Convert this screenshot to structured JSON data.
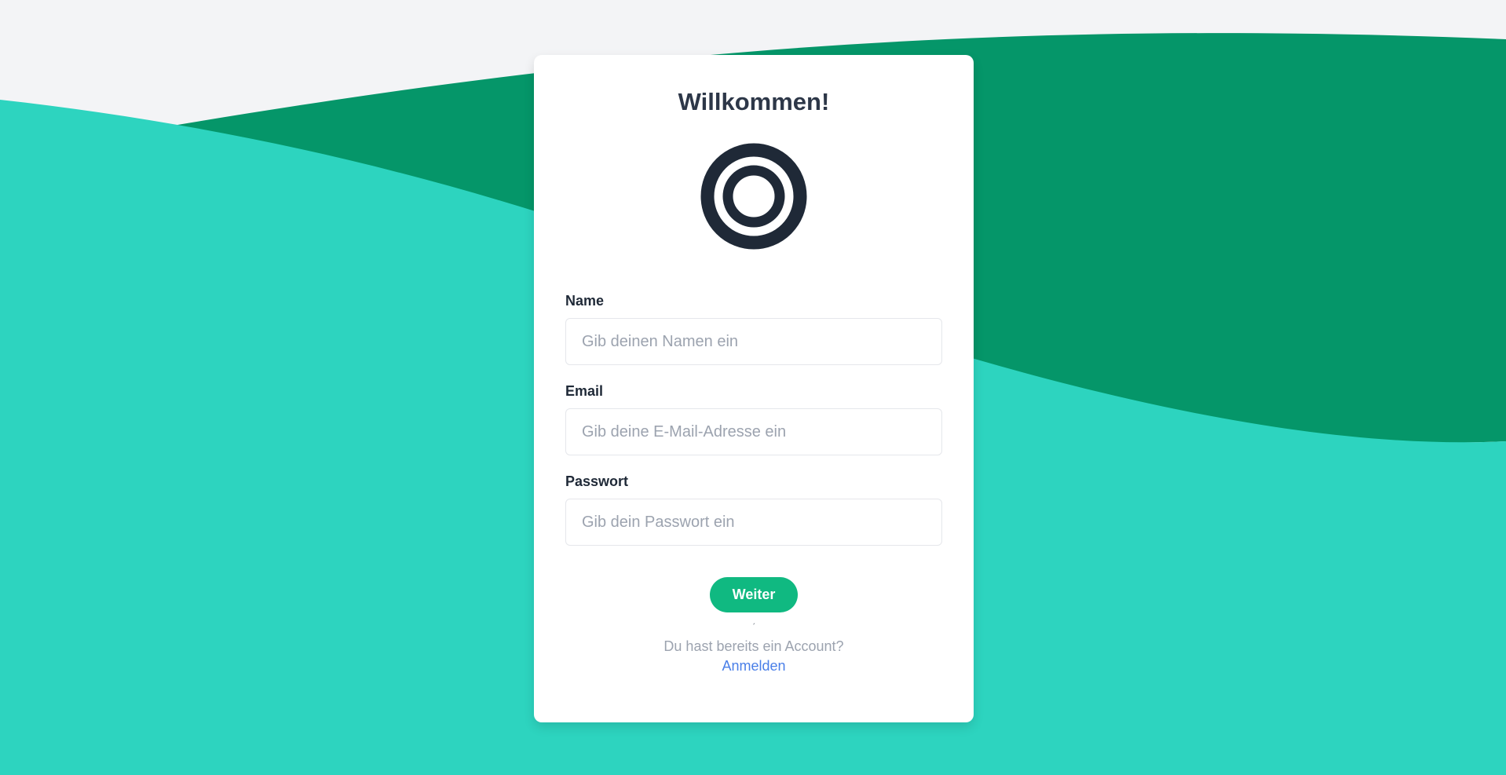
{
  "colors": {
    "background": "#f3f4f6",
    "wave_dark": "#059669",
    "wave_light": "#2dd4bf",
    "accent": "#10b981",
    "link": "#4a7fe8",
    "logo": "#1f2937"
  },
  "card": {
    "title": "Willkommen!",
    "logo_icon": "concentric-circles-icon"
  },
  "form": {
    "name": {
      "label": "Name",
      "placeholder": "Gib deinen Namen ein",
      "value": ""
    },
    "email": {
      "label": "Email",
      "placeholder": "Gib deine E-Mail-Adresse ein",
      "value": ""
    },
    "password": {
      "label": "Passwort",
      "placeholder": "Gib dein Passwort ein",
      "value": ""
    },
    "submit_label": "Weiter"
  },
  "footer": {
    "account_text": "Du hast bereits ein Account?",
    "login_link": "Anmelden"
  }
}
